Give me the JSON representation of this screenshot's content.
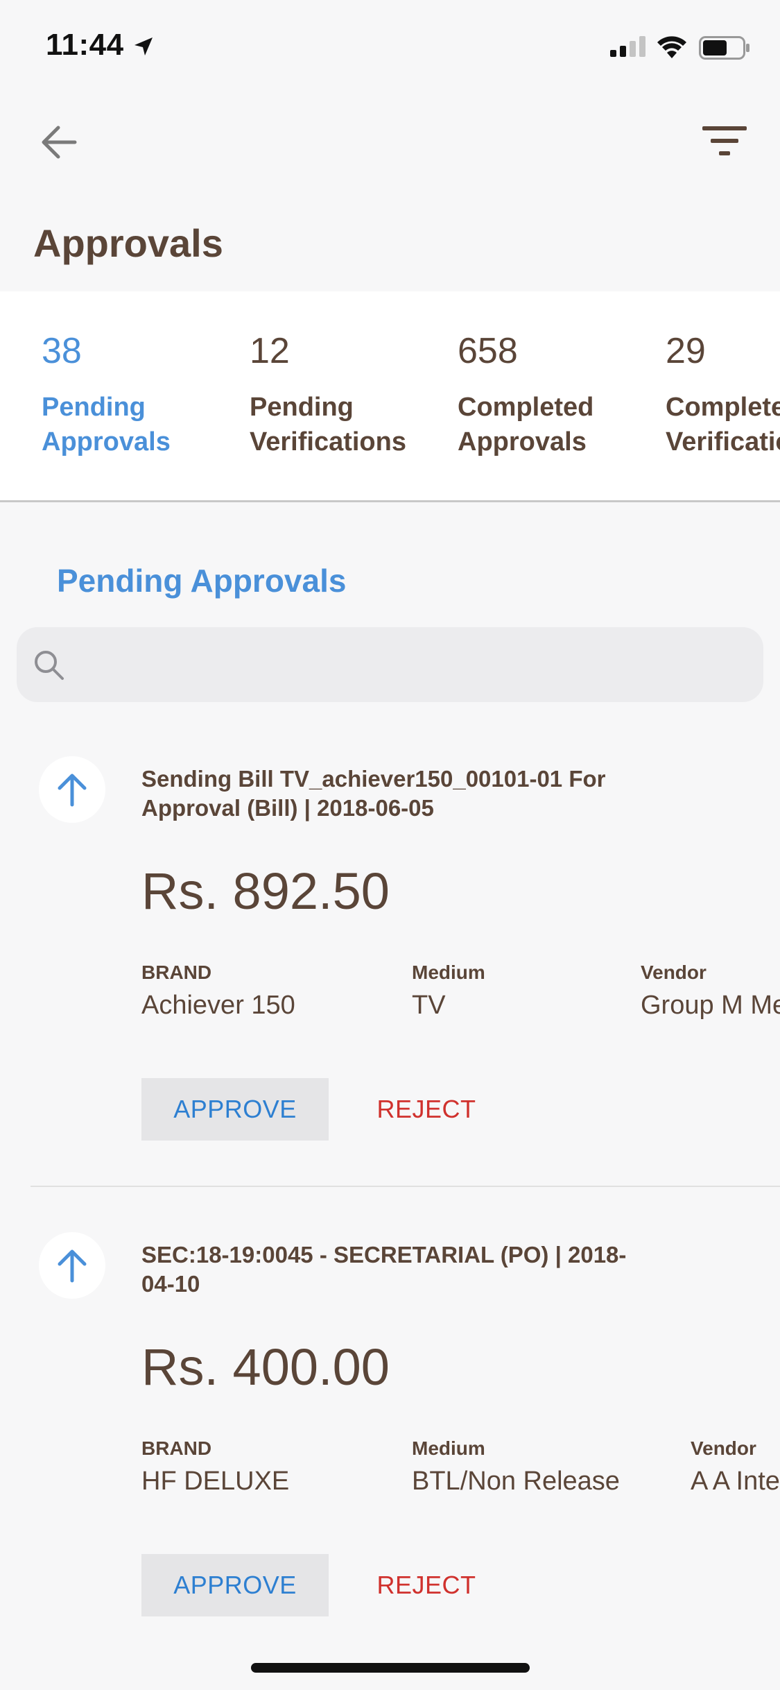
{
  "status_bar": {
    "time": "11:44",
    "icons": [
      "location-arrow-icon",
      "signal-icon",
      "wifi-icon",
      "battery-icon"
    ]
  },
  "navbar": {
    "back_icon": "back-arrow-icon",
    "filter_icon": "filter-icon"
  },
  "page": {
    "title": "Approvals"
  },
  "stats": [
    {
      "count": "38",
      "label": "Pending\nApprovals",
      "active": true
    },
    {
      "count": "12",
      "label": "Pending\nVerifications",
      "active": false
    },
    {
      "count": "658",
      "label": "Completed\nApprovals",
      "active": false
    },
    {
      "count": "29",
      "label": "Completed\nVerifications",
      "active": false
    }
  ],
  "section": {
    "title": "Pending Approvals"
  },
  "search": {
    "placeholder": ""
  },
  "cards": [
    {
      "title": "Sending Bill TV_achiever150_00101-01 For Approval  (Bill) | 2018-06-05",
      "amount": "Rs. 892.50",
      "fields": [
        {
          "label": "BRAND",
          "value": "Achiever 150"
        },
        {
          "label": "Medium",
          "value": "TV"
        },
        {
          "label": "Vendor",
          "value": "Group M Media"
        }
      ],
      "approve_label": "APPROVE",
      "reject_label": "REJECT"
    },
    {
      "title": "SEC:18-19:0045 - SECRETARIAL (PO) | 2018-04-10",
      "amount": "Rs. 400.00",
      "fields": [
        {
          "label": "BRAND",
          "value": "HF DELUXE"
        },
        {
          "label": "Medium",
          "value": "BTL/Non Release"
        },
        {
          "label": "Vendor",
          "value": "A A International"
        }
      ],
      "approve_label": "APPROVE",
      "reject_label": "REJECT"
    }
  ],
  "colors": {
    "accent": "#4a90d9",
    "approve": "#2d7fd1",
    "reject": "#d0312d",
    "text": "#5a4538",
    "background": "#f7f7f8"
  }
}
